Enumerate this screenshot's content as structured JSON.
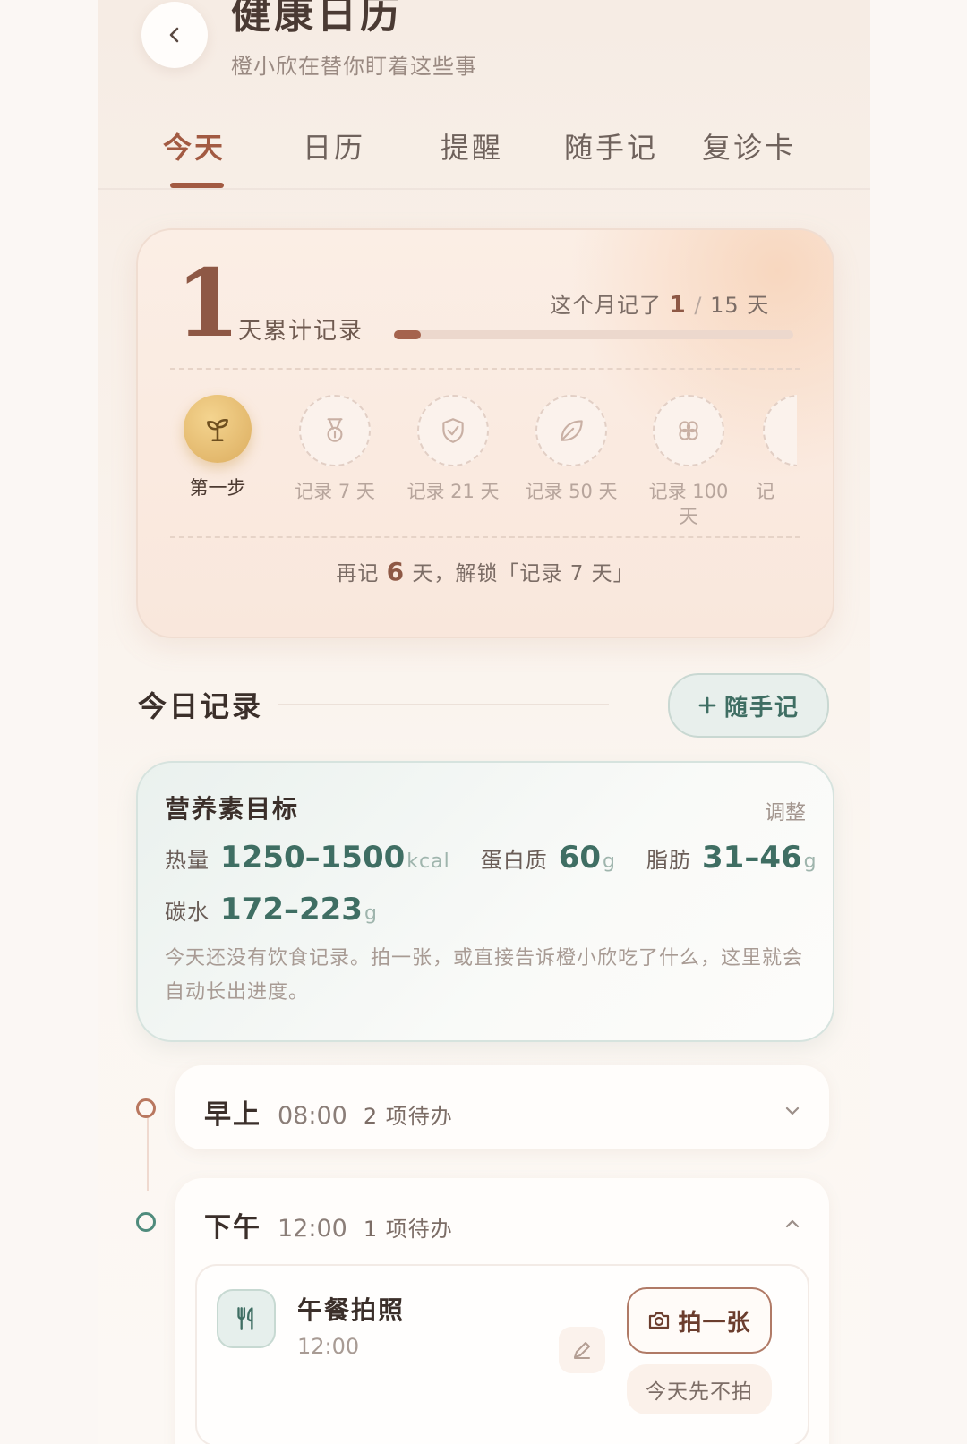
{
  "header": {
    "title": "健康日历",
    "subtitle": "橙小欣在替你盯着这些事"
  },
  "tabs": [
    {
      "label": "今天",
      "active": true
    },
    {
      "label": "日历"
    },
    {
      "label": "提醒"
    },
    {
      "label": "随手记"
    },
    {
      "label": "复诊卡"
    }
  ],
  "stats": {
    "total_days": "1",
    "total_label": "天累计记录",
    "month_prefix": "这个月记了",
    "month_done": "1",
    "month_sep": "/",
    "month_total": "15 天",
    "month_progress": 0.067,
    "badges": [
      {
        "label": "第一步",
        "icon": "sprout-icon",
        "unlocked": true
      },
      {
        "label": "记录 7 天",
        "icon": "medal-icon",
        "unlocked": false
      },
      {
        "label": "记录 21 天",
        "icon": "shield-check-icon",
        "unlocked": false
      },
      {
        "label": "记录 50 天",
        "icon": "leaf-icon",
        "unlocked": false
      },
      {
        "label": "记录 100 天",
        "icon": "flower-icon",
        "unlocked": false
      },
      {
        "label": "记",
        "icon": "more-icon",
        "unlocked": false
      }
    ],
    "unlock_prefix": "再记",
    "unlock_days": "6",
    "unlock_suffix": "天，解锁「记录 7 天」"
  },
  "today": {
    "section_title": "今日记录",
    "quick_note_label": "随手记"
  },
  "nutrition": {
    "title": "营养素目标",
    "adjust_label": "调整",
    "items": [
      {
        "name": "热量",
        "value": "1250–1500",
        "unit": "kcal"
      },
      {
        "name": "蛋白质",
        "value": "60",
        "unit": "g"
      },
      {
        "name": "脂肪",
        "value": "31–46",
        "unit": "g"
      },
      {
        "name": "碳水",
        "value": "172–223",
        "unit": "g"
      }
    ],
    "hint": "今天还没有饮食记录。拍一张，或直接告诉橙小欣吃了什么，这里就会自动长出进度。"
  },
  "slots": [
    {
      "name": "早上",
      "time": "08:00",
      "count": "2 项待办",
      "expanded": false
    },
    {
      "name": "下午",
      "time": "12:00",
      "count": "1 项待办",
      "expanded": true
    }
  ],
  "task": {
    "title": "午餐拍照",
    "time": "12:00",
    "photo_label": "拍一张",
    "skip_label": "今天先不拍"
  },
  "colors": {
    "accent": "#a25a42",
    "green": "#3f6e63",
    "gold": "#dcad5f"
  }
}
